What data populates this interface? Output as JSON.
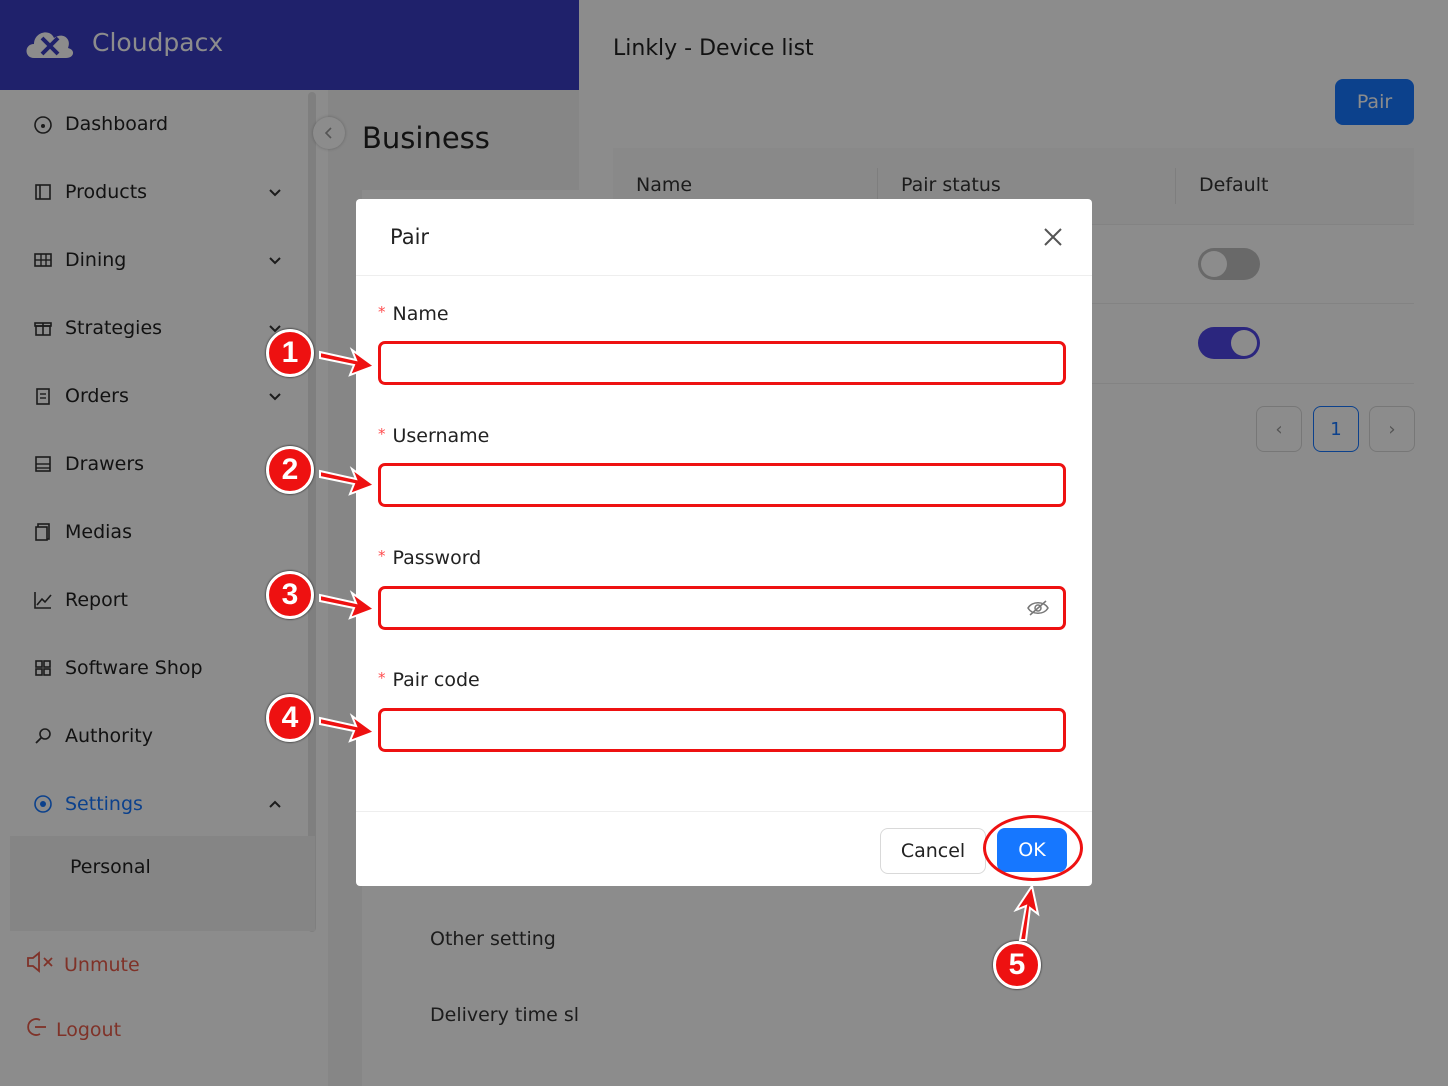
{
  "brand": {
    "name": "Cloudpacx"
  },
  "sidebar": {
    "items": [
      {
        "label": "Dashboard",
        "icon": "dashboard-icon"
      },
      {
        "label": "Products",
        "icon": "products-icon"
      },
      {
        "label": "Dining",
        "icon": "dining-icon"
      },
      {
        "label": "Strategies",
        "icon": "gift-icon"
      },
      {
        "label": "Orders",
        "icon": "clipboard-icon"
      },
      {
        "label": "Drawers",
        "icon": "drawer-icon"
      },
      {
        "label": "Medias",
        "icon": "media-icon"
      },
      {
        "label": "Report",
        "icon": "chart-icon"
      },
      {
        "label": "Software Shop",
        "icon": "apps-icon"
      },
      {
        "label": "Authority",
        "icon": "key-icon"
      },
      {
        "label": "Settings",
        "icon": "settings-icon"
      }
    ],
    "sub_item": "Personal",
    "unmute": "Unmute",
    "logout": "Logout"
  },
  "middle": {
    "title": "Business",
    "links": [
      "Other setting",
      "Delivery time slo"
    ]
  },
  "device_list": {
    "title": "Linkly - Device list",
    "pair_button": "Pair",
    "columns": [
      "Name",
      "Pair status",
      "Default"
    ],
    "rows": [
      {
        "default_on": false
      },
      {
        "default_on": true
      }
    ],
    "pagination": {
      "current_page": "1"
    }
  },
  "modal": {
    "title": "Pair",
    "fields": [
      {
        "label": "Name",
        "required_mark": "*",
        "value": ""
      },
      {
        "label": "Username",
        "required_mark": "*",
        "value": ""
      },
      {
        "label": "Password",
        "required_mark": "*",
        "value": ""
      },
      {
        "label": "Pair code",
        "required_mark": "*",
        "value": ""
      }
    ],
    "cancel_label": "Cancel",
    "ok_label": "OK"
  },
  "annotations": [
    "1",
    "2",
    "3",
    "4",
    "5"
  ],
  "colors": {
    "brand": "#3a3cc4",
    "primary": "#1677ff",
    "danger": "#ff4d4f",
    "annotation": "#ee1111",
    "toggle_on": "#4f46e5"
  }
}
